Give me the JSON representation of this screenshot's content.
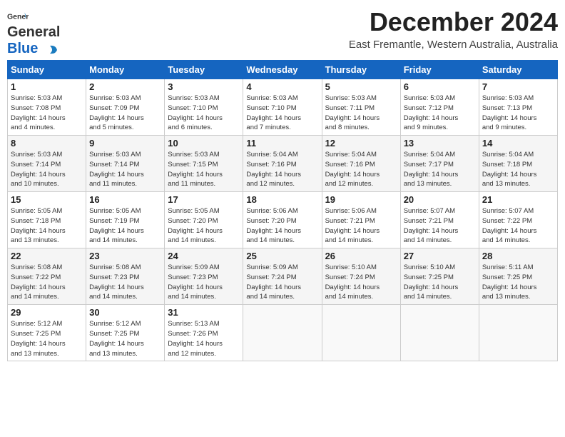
{
  "header": {
    "logo_line1": "General",
    "logo_line2": "Blue",
    "month_title": "December 2024",
    "location": "East Fremantle, Western Australia, Australia"
  },
  "weekdays": [
    "Sunday",
    "Monday",
    "Tuesday",
    "Wednesday",
    "Thursday",
    "Friday",
    "Saturday"
  ],
  "weeks": [
    [
      {
        "day": "1",
        "sunrise": "5:03 AM",
        "sunset": "7:08 PM",
        "daylight": "14 hours and 4 minutes."
      },
      {
        "day": "2",
        "sunrise": "5:03 AM",
        "sunset": "7:09 PM",
        "daylight": "14 hours and 5 minutes."
      },
      {
        "day": "3",
        "sunrise": "5:03 AM",
        "sunset": "7:10 PM",
        "daylight": "14 hours and 6 minutes."
      },
      {
        "day": "4",
        "sunrise": "5:03 AM",
        "sunset": "7:10 PM",
        "daylight": "14 hours and 7 minutes."
      },
      {
        "day": "5",
        "sunrise": "5:03 AM",
        "sunset": "7:11 PM",
        "daylight": "14 hours and 8 minutes."
      },
      {
        "day": "6",
        "sunrise": "5:03 AM",
        "sunset": "7:12 PM",
        "daylight": "14 hours and 9 minutes."
      },
      {
        "day": "7",
        "sunrise": "5:03 AM",
        "sunset": "7:13 PM",
        "daylight": "14 hours and 9 minutes."
      }
    ],
    [
      {
        "day": "8",
        "sunrise": "5:03 AM",
        "sunset": "7:14 PM",
        "daylight": "14 hours and 10 minutes."
      },
      {
        "day": "9",
        "sunrise": "5:03 AM",
        "sunset": "7:14 PM",
        "daylight": "14 hours and 11 minutes."
      },
      {
        "day": "10",
        "sunrise": "5:03 AM",
        "sunset": "7:15 PM",
        "daylight": "14 hours and 11 minutes."
      },
      {
        "day": "11",
        "sunrise": "5:04 AM",
        "sunset": "7:16 PM",
        "daylight": "14 hours and 12 minutes."
      },
      {
        "day": "12",
        "sunrise": "5:04 AM",
        "sunset": "7:16 PM",
        "daylight": "14 hours and 12 minutes."
      },
      {
        "day": "13",
        "sunrise": "5:04 AM",
        "sunset": "7:17 PM",
        "daylight": "14 hours and 13 minutes."
      },
      {
        "day": "14",
        "sunrise": "5:04 AM",
        "sunset": "7:18 PM",
        "daylight": "14 hours and 13 minutes."
      }
    ],
    [
      {
        "day": "15",
        "sunrise": "5:05 AM",
        "sunset": "7:18 PM",
        "daylight": "14 hours and 13 minutes."
      },
      {
        "day": "16",
        "sunrise": "5:05 AM",
        "sunset": "7:19 PM",
        "daylight": "14 hours and 14 minutes."
      },
      {
        "day": "17",
        "sunrise": "5:05 AM",
        "sunset": "7:20 PM",
        "daylight": "14 hours and 14 minutes."
      },
      {
        "day": "18",
        "sunrise": "5:06 AM",
        "sunset": "7:20 PM",
        "daylight": "14 hours and 14 minutes."
      },
      {
        "day": "19",
        "sunrise": "5:06 AM",
        "sunset": "7:21 PM",
        "daylight": "14 hours and 14 minutes."
      },
      {
        "day": "20",
        "sunrise": "5:07 AM",
        "sunset": "7:21 PM",
        "daylight": "14 hours and 14 minutes."
      },
      {
        "day": "21",
        "sunrise": "5:07 AM",
        "sunset": "7:22 PM",
        "daylight": "14 hours and 14 minutes."
      }
    ],
    [
      {
        "day": "22",
        "sunrise": "5:08 AM",
        "sunset": "7:22 PM",
        "daylight": "14 hours and 14 minutes."
      },
      {
        "day": "23",
        "sunrise": "5:08 AM",
        "sunset": "7:23 PM",
        "daylight": "14 hours and 14 minutes."
      },
      {
        "day": "24",
        "sunrise": "5:09 AM",
        "sunset": "7:23 PM",
        "daylight": "14 hours and 14 minutes."
      },
      {
        "day": "25",
        "sunrise": "5:09 AM",
        "sunset": "7:24 PM",
        "daylight": "14 hours and 14 minutes."
      },
      {
        "day": "26",
        "sunrise": "5:10 AM",
        "sunset": "7:24 PM",
        "daylight": "14 hours and 14 minutes."
      },
      {
        "day": "27",
        "sunrise": "5:10 AM",
        "sunset": "7:25 PM",
        "daylight": "14 hours and 14 minutes."
      },
      {
        "day": "28",
        "sunrise": "5:11 AM",
        "sunset": "7:25 PM",
        "daylight": "14 hours and 13 minutes."
      }
    ],
    [
      {
        "day": "29",
        "sunrise": "5:12 AM",
        "sunset": "7:25 PM",
        "daylight": "14 hours and 13 minutes."
      },
      {
        "day": "30",
        "sunrise": "5:12 AM",
        "sunset": "7:25 PM",
        "daylight": "14 hours and 13 minutes."
      },
      {
        "day": "31",
        "sunrise": "5:13 AM",
        "sunset": "7:26 PM",
        "daylight": "14 hours and 12 minutes."
      },
      null,
      null,
      null,
      null
    ]
  ],
  "labels": {
    "sunrise_prefix": "Sunrise: ",
    "sunset_prefix": "Sunset: ",
    "daylight_prefix": "Daylight: "
  }
}
